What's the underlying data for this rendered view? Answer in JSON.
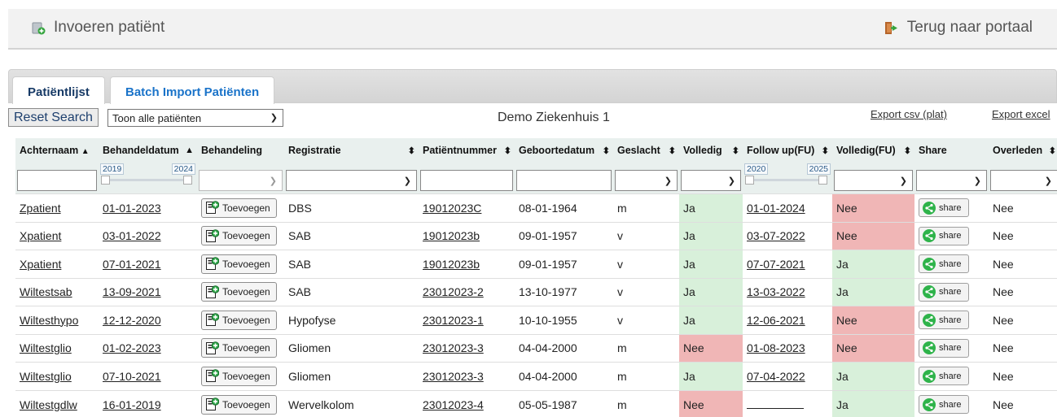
{
  "header": {
    "left_label": "Invoeren patiënt",
    "right_label": "Terug naar portaal"
  },
  "tabs": [
    {
      "label": "Patiëntlijst",
      "active": true
    },
    {
      "label": "Batch Import Patiënten",
      "active": false
    }
  ],
  "toolbar": {
    "reset_label": "Reset Search",
    "filter_select": "Toon alle patiënten",
    "hospital": "Demo Ziekenhuis 1",
    "export_csv": "Export csv (plat)",
    "export_excel": "Export excel"
  },
  "columns": [
    "Achternaam",
    "Behandeldatum",
    "Behandeling",
    "Registratie",
    "Patiëntnummer",
    "Geboortedatum",
    "Geslacht",
    "Volledig",
    "Follow up(FU)",
    "Volledig(FU)",
    "Share",
    "Overleden"
  ],
  "range_filters": {
    "behandeldatum": {
      "from": "2019",
      "to": "2024"
    },
    "follow_up": {
      "from": "2020",
      "to": "2025"
    }
  },
  "add_button_label": "Toevoegen",
  "share_button_label": "share",
  "colors": {
    "ok": "#d8f0da",
    "missing": "#f0b6b6"
  },
  "rows": [
    {
      "achternaam": "Zpatient",
      "behandeldatum": "01-01-2023",
      "registratie": "DBS",
      "patientnummer": "19012023C",
      "geboortedatum": "08-01-1964",
      "geslacht": "m",
      "volledig": "Ja",
      "follow_up": "01-01-2024",
      "volledig_fu": "Nee",
      "overleden": "Nee"
    },
    {
      "achternaam": "Xpatient",
      "behandeldatum": "03-01-2022",
      "registratie": "SAB",
      "patientnummer": "19012023b",
      "geboortedatum": "09-01-1957",
      "geslacht": "v",
      "volledig": "Ja",
      "follow_up": "03-07-2022",
      "volledig_fu": "Nee",
      "overleden": "Nee"
    },
    {
      "achternaam": "Xpatient",
      "behandeldatum": "07-01-2021",
      "registratie": "SAB",
      "patientnummer": "19012023b",
      "geboortedatum": "09-01-1957",
      "geslacht": "v",
      "volledig": "Ja",
      "follow_up": "07-07-2021",
      "volledig_fu": "Ja",
      "overleden": "Nee"
    },
    {
      "achternaam": "Wiltestsab",
      "behandeldatum": "13-09-2021",
      "registratie": "SAB",
      "patientnummer": "23012023-2",
      "geboortedatum": "13-10-1977",
      "geslacht": "v",
      "volledig": "Ja",
      "follow_up": "13-03-2022",
      "volledig_fu": "Ja",
      "overleden": "Nee"
    },
    {
      "achternaam": "Wiltesthypo",
      "behandeldatum": "12-12-2020",
      "registratie": "Hypofyse",
      "patientnummer": "23012023-1",
      "geboortedatum": "10-10-1955",
      "geslacht": "v",
      "volledig": "Ja",
      "follow_up": "12-06-2021",
      "volledig_fu": "Nee",
      "overleden": "Nee"
    },
    {
      "achternaam": "Wiltestglio",
      "behandeldatum": "01-02-2023",
      "registratie": "Gliomen",
      "patientnummer": "23012023-3",
      "geboortedatum": "04-04-2000",
      "geslacht": "m",
      "volledig": "Nee",
      "follow_up": "01-08-2023",
      "volledig_fu": "Nee",
      "overleden": "Nee"
    },
    {
      "achternaam": "Wiltestglio",
      "behandeldatum": "07-10-2021",
      "registratie": "Gliomen",
      "patientnummer": "23012023-3",
      "geboortedatum": "04-04-2000",
      "geslacht": "m",
      "volledig": "Ja",
      "follow_up": "07-04-2022",
      "volledig_fu": "Ja",
      "overleden": "Nee"
    },
    {
      "achternaam": "Wiltestgdlw",
      "behandeldatum": "16-01-2019",
      "registratie": "Wervelkolom",
      "patientnummer": "23012023-4",
      "geboortedatum": "05-05-1987",
      "geslacht": "m",
      "volledig": "Nee",
      "follow_up": "",
      "volledig_fu": "Ja",
      "overleden": "Nee"
    }
  ]
}
